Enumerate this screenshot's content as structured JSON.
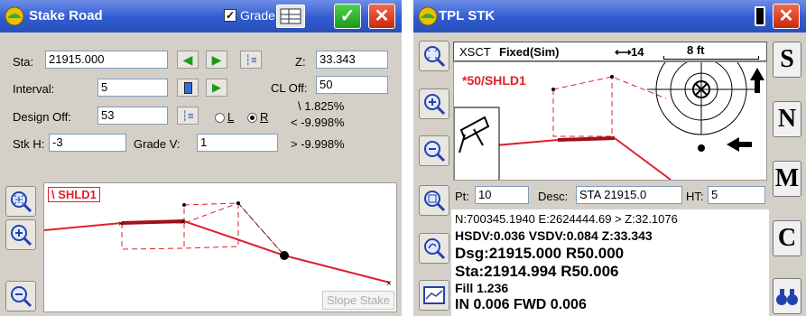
{
  "left": {
    "title": "Stake Road",
    "grade_checkbox_label": "Grade",
    "ok_label": "✓",
    "close_label": "✕",
    "sta_label": "Sta:",
    "sta_value": "21915.000",
    "z_label": "Z:",
    "z_value": "33.343",
    "interval_label": "Interval:",
    "interval_value": "5",
    "cl_off_label": "CL Off:",
    "cl_off_value": "50",
    "design_off_label": "Design Off:",
    "design_off_value": "53",
    "radio_l": "L",
    "radio_r": "R",
    "slope_1": "\\ 1.825%",
    "slope_2": "< -9.998%",
    "slope_3": "> -9.998%",
    "stk_h_label": "Stk H:",
    "stk_h_value": "-3",
    "grade_v_label": "Grade V:",
    "grade_v_value": "1",
    "plot_label": "\\ SHLD1",
    "slope_stake_label": "Slope Stake"
  },
  "right": {
    "title": "TPL STK",
    "close_label": "✕",
    "mode": "XSCT",
    "fix_status": "Fixed(Sim)",
    "satellites": "14",
    "scale": "8 ft",
    "point_label": "*50/SHLD1",
    "pt_label": "Pt:",
    "pt_value": "10",
    "desc_label": "Desc:",
    "desc_value": "STA 21915.0",
    "ht_label": "HT:",
    "ht_value": "5",
    "line_coords": "N:700345.1940 E:2624444.69 > Z:32.1076",
    "line_hsdv": "HSDV:0.036 VSDV:0.084 Z:33.343",
    "line_dsg": "Dsg:21915.000 R50.000",
    "line_sta": "Sta:21914.994 R50.006",
    "line_fill": "Fill 1.236",
    "line_in": "IN 0.006 FWD 0.006",
    "side_buttons": [
      "S",
      "N",
      "M",
      "C"
    ]
  },
  "colors": {
    "titlebar": "#2f5bd1",
    "accent_red": "#e0202a",
    "ok_green": "#1a9a1a",
    "panel_bg": "#d4d0c8"
  }
}
